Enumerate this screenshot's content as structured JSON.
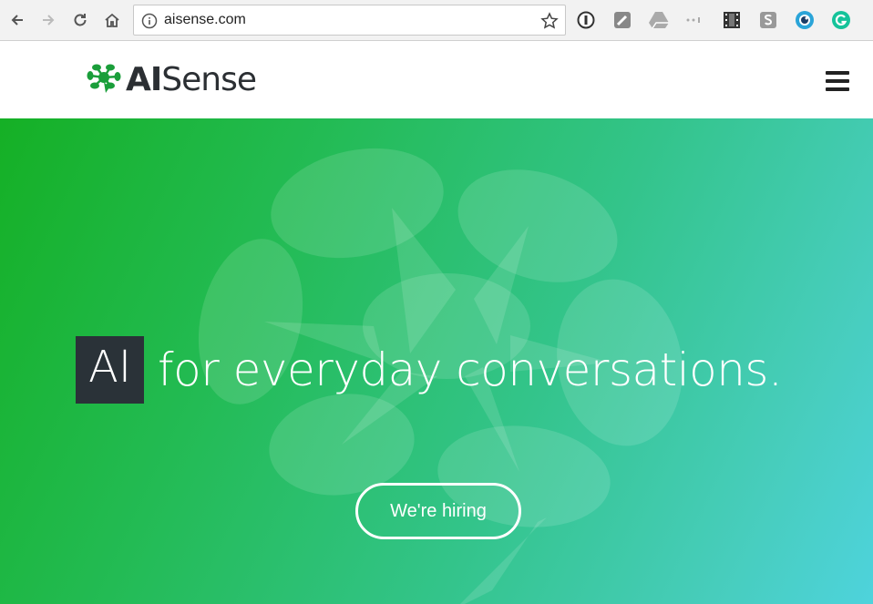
{
  "browser": {
    "url": "aisense.com",
    "nav_icons": [
      "back-arrow-icon",
      "forward-arrow-icon",
      "reload-icon",
      "home-icon"
    ],
    "extensions": [
      "one-password-icon",
      "sticky-note-icon",
      "google-drive-icon",
      "dots-extension-icon",
      "film-strip-icon",
      "s-extension-icon",
      "eye-extension-icon",
      "grammarly-icon"
    ]
  },
  "site": {
    "logo": {
      "bold": "AI",
      "light": "Sense"
    },
    "menu_icon": "hamburger-menu-icon"
  },
  "hero": {
    "highlight": "AI",
    "tagline": "for everyday conversations.",
    "cta_label": "We're hiring"
  },
  "colors": {
    "brand_green": "#1a9e3a",
    "logo_dark": "#2b2f33",
    "ai_box": "#2a3238",
    "gradient_start": "#15b025",
    "gradient_end": "#4ed3dc"
  }
}
